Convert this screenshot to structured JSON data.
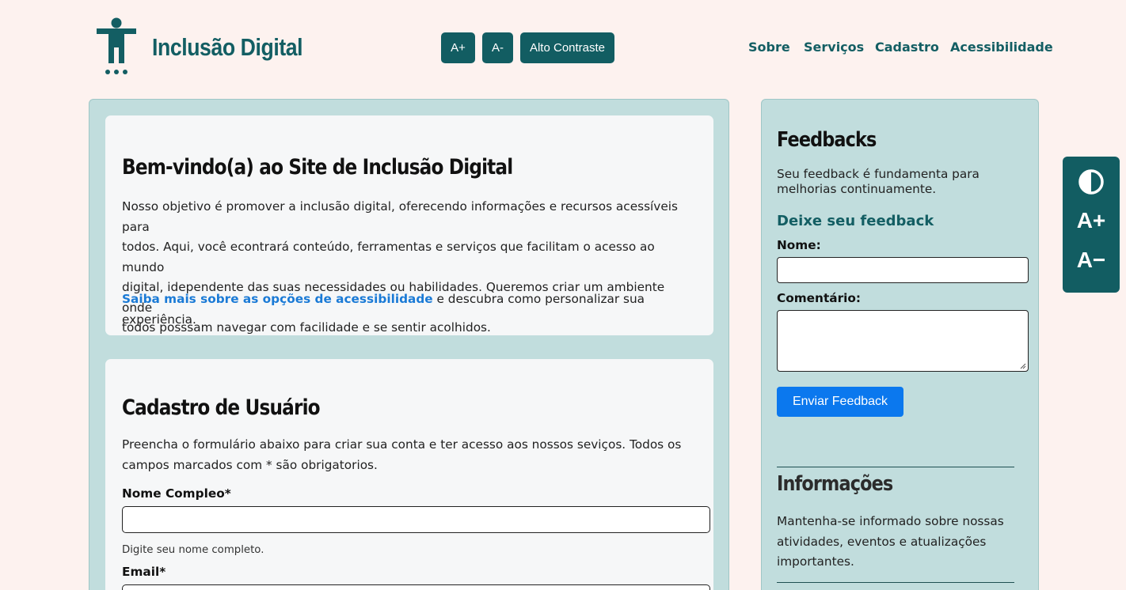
{
  "header": {
    "brand": "Inclusão Digital",
    "font_buttons": {
      "increase": "A+",
      "decrease": "A-",
      "contrast": "Alto Contraste"
    },
    "nav": [
      "Sobre",
      "Serviços",
      "Cadastro",
      "Acessibilidade"
    ]
  },
  "welcome": {
    "title": "Bem-vindo(a) ao Site de Inclusão Digital",
    "lines": [
      "Nosso objetivo é promover a inclusão digital, oferecendo informações e recursos acessíveis para",
      "todos. Aqui, você econtrará conteúdo, ferramentas e serviços que facilitam o acesso ao mundo",
      "digital, idependente das suas necessidades ou habilidades. Queremos criar um ambiente onde",
      "todos posssam navegar com facilidade e se sentir acolhidos."
    ],
    "link_text": "Saiba mais sobre as opções de acessibilidade",
    "link_suffix": " e descubra como personalizar sua experiência."
  },
  "register": {
    "title": "Cadastro de Usuário",
    "lines": [
      "Preencha o formulário abaixo para criar sua conta e ter acesso aos nossos seviços. Todos os",
      "campos marcados com * são obrigatorios."
    ],
    "name_label": "Nome Compleo*",
    "name_hint": "Digite seu nome completo.",
    "email_label": "Email*"
  },
  "sidebar": {
    "title": "Feedbacks",
    "intro_lines": [
      "Seu feedback é fundamenta para",
      "melhorias continuamente."
    ],
    "form_title": "Deixe seu feedback",
    "name_label": "Nome:",
    "comment_label": "Comentário:",
    "submit": "Enviar Feedback",
    "info_title": "Informações",
    "info_lines": [
      "Mantenha-se informado sobre nossas",
      "atividades, eventos e atualizações",
      "importantes."
    ]
  },
  "floating_panel": {
    "contrast_icon": "contrast-icon",
    "increase": "A+",
    "decrease": "A−"
  },
  "colors": {
    "background": "#fdf2ef",
    "brand": "#135e63",
    "panel": "#c1dddd",
    "card": "#f6f7f8",
    "link": "#1a7ad6",
    "submit": "#0b78ee"
  }
}
